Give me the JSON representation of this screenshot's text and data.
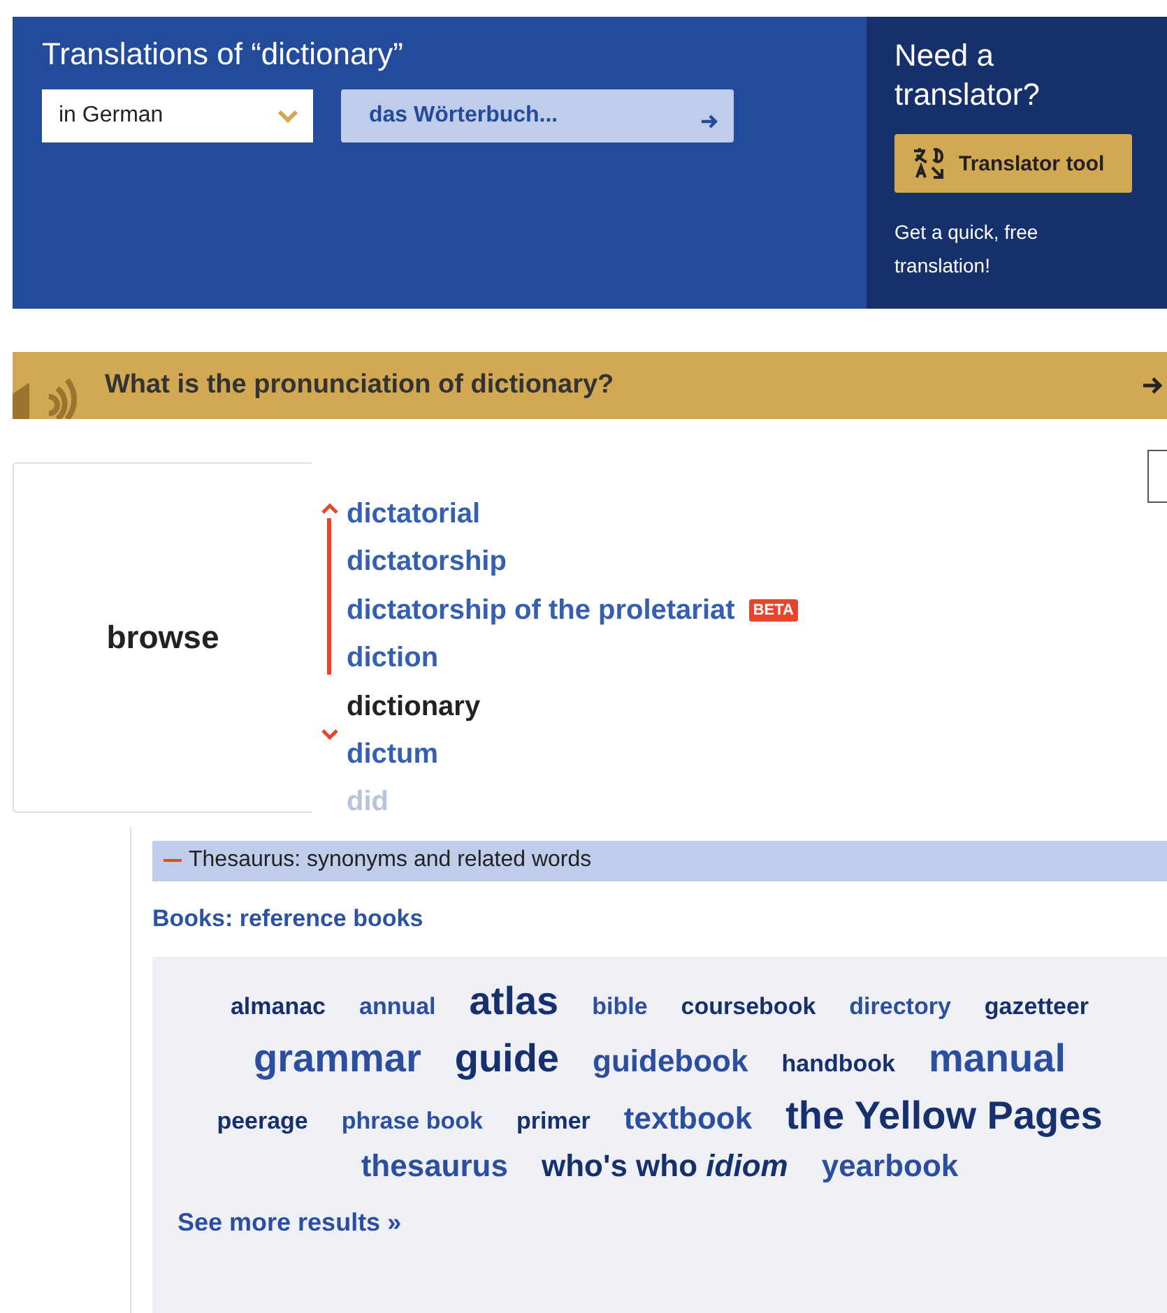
{
  "translation": {
    "title": "Translations of “dictionary”",
    "language": "in German",
    "result": "das Wörterbuch..."
  },
  "translator": {
    "title": "Need a translator?",
    "button": "Translator tool",
    "note": "Get a quick, free translation!"
  },
  "pronunciation": {
    "question": "What is the pronunciation of dictionary?"
  },
  "browse": {
    "label": "browse",
    "items": [
      {
        "text": "dictatorial",
        "selected": false,
        "faded": false
      },
      {
        "text": "dictatorship",
        "selected": false,
        "faded": false
      },
      {
        "text": "dictatorship of the proletariat",
        "badge": "BETA",
        "selected": false,
        "faded": false
      },
      {
        "text": "diction",
        "selected": false,
        "faded": false
      },
      {
        "text": "dictionary",
        "selected": true,
        "faded": false
      },
      {
        "text": "dictum",
        "selected": false,
        "faded": false
      },
      {
        "text": "did",
        "selected": false,
        "faded": true
      }
    ]
  },
  "thesaurus": {
    "heading": "Thesaurus: synonyms and related words",
    "category": "Books: reference books",
    "words": [
      {
        "text": "almanac",
        "kind": "small",
        "color": "#15306d"
      },
      {
        "text": "annual",
        "kind": "small",
        "color": "#2b4f9e"
      },
      {
        "text": "atlas",
        "kind": "large",
        "color": "#15306d"
      },
      {
        "text": "bible",
        "kind": "small",
        "color": "#2b4f9e"
      },
      {
        "text": "coursebook",
        "kind": "small",
        "color": "#15306d"
      },
      {
        "text": "directory",
        "kind": "small",
        "color": "#2b4f9e"
      },
      {
        "text": "gazetteer",
        "kind": "small",
        "color": "#15306d"
      },
      {
        "text": "grammar",
        "kind": "large",
        "color": "#2b4f9e"
      },
      {
        "text": "guide",
        "kind": "large",
        "color": "#15306d"
      },
      {
        "text": "guidebook",
        "kind": "medium",
        "color": "#2b4f9e"
      },
      {
        "text": "handbook",
        "kind": "small",
        "color": "#15306d"
      },
      {
        "text": "manual",
        "kind": "large",
        "color": "#2b4f9e"
      },
      {
        "text": "peerage",
        "kind": "small",
        "color": "#15306d"
      },
      {
        "text": "phrase book",
        "kind": "small",
        "color": "#2b4f9e"
      },
      {
        "text": "primer",
        "kind": "small",
        "color": "#15306d"
      },
      {
        "text": "textbook",
        "kind": "medium",
        "color": "#2b4f9e"
      },
      {
        "text": "the Yellow Pages",
        "kind": "large",
        "color": "#15306d"
      },
      {
        "text": "thesaurus",
        "kind": "medium",
        "color": "#2b4f9e"
      },
      {
        "text": "who's who *idiom*",
        "kind": "medium",
        "color": "#15306d"
      },
      {
        "text": "yearbook",
        "kind": "medium",
        "color": "#2b4f9e"
      }
    ],
    "more": "See more results »"
  }
}
